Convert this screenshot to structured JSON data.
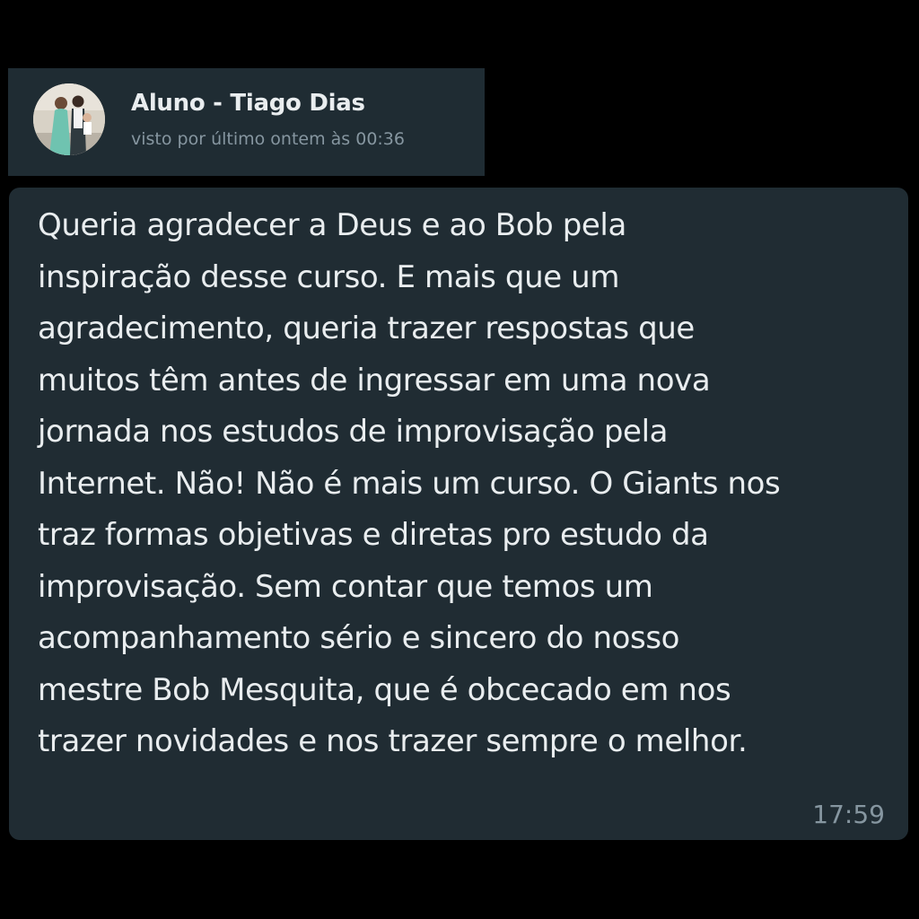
{
  "header": {
    "contact_name": "Aluno - Tiago Dias",
    "status": "visto por último ontem às 00:36",
    "avatar_icon": "profile-photo"
  },
  "message": {
    "text": "Queria agradecer a Deus e ao Bob pela\ninspiração desse curso. E mais que um\nagradecimento, queria trazer respostas que\nmuitos têm antes de ingressar em uma nova\njornada nos estudos de improvisação pela\nInternet. Não! Não é mais um curso. O Giants nos\ntraz formas objetivas e diretas pro estudo da\nimprovisação. Sem contar que temos um\nacompanhamento sério e sincero do nosso\nmestre Bob Mesquita, que é obcecado em nos\ntrazer novidades e nos trazer sempre o melhor.",
    "time": "17:59"
  },
  "colors": {
    "background": "#000000",
    "header_bg": "#1f2c33",
    "bubble_bg": "#202c33",
    "primary_text": "#e9edef",
    "secondary_text": "#8696a0"
  }
}
